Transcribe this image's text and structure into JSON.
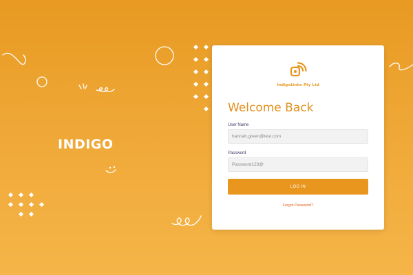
{
  "brand": {
    "title": "INDIGO"
  },
  "logo": {
    "company_name": "IndigoLinks Pty Ltd",
    "icon": "wifi-signal-logo-icon"
  },
  "login_card": {
    "heading": "Welcome Back",
    "username_label": "User Name",
    "username_value": "hannah.green@test.com",
    "password_label": "Password",
    "password_value": "Password123@",
    "login_button": "LOG IN",
    "forgot_link": "Forgot Password?"
  },
  "colors": {
    "background": "#e89a22",
    "accent": "#e8961e",
    "card": "#ffffff",
    "link": "#e0621c"
  }
}
